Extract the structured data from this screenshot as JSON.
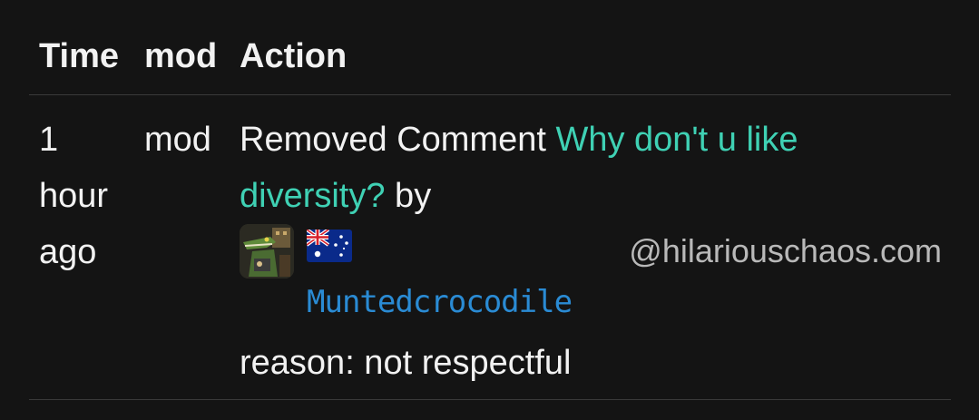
{
  "headers": {
    "time": "Time",
    "mod": "mod",
    "action": "Action"
  },
  "row": {
    "time_line1": "1",
    "time_line2": "hour",
    "time_line3": "ago",
    "mod": "mod",
    "action_prefix": "Removed Comment ",
    "comment_link": "Why don't u like diversity?",
    "action_by": " by",
    "user_avatar_icon": "crocodile-avatar-icon",
    "user_flag_icon": "australia-flag-icon",
    "username": "Muntedcrocodile",
    "instance": "@hilariouschaos.com",
    "reason": "reason: not respectful"
  },
  "colors": {
    "background": "#141414",
    "link": "#3fd1b4",
    "username": "#2a8bd4",
    "instance": "#b9b9b9"
  }
}
